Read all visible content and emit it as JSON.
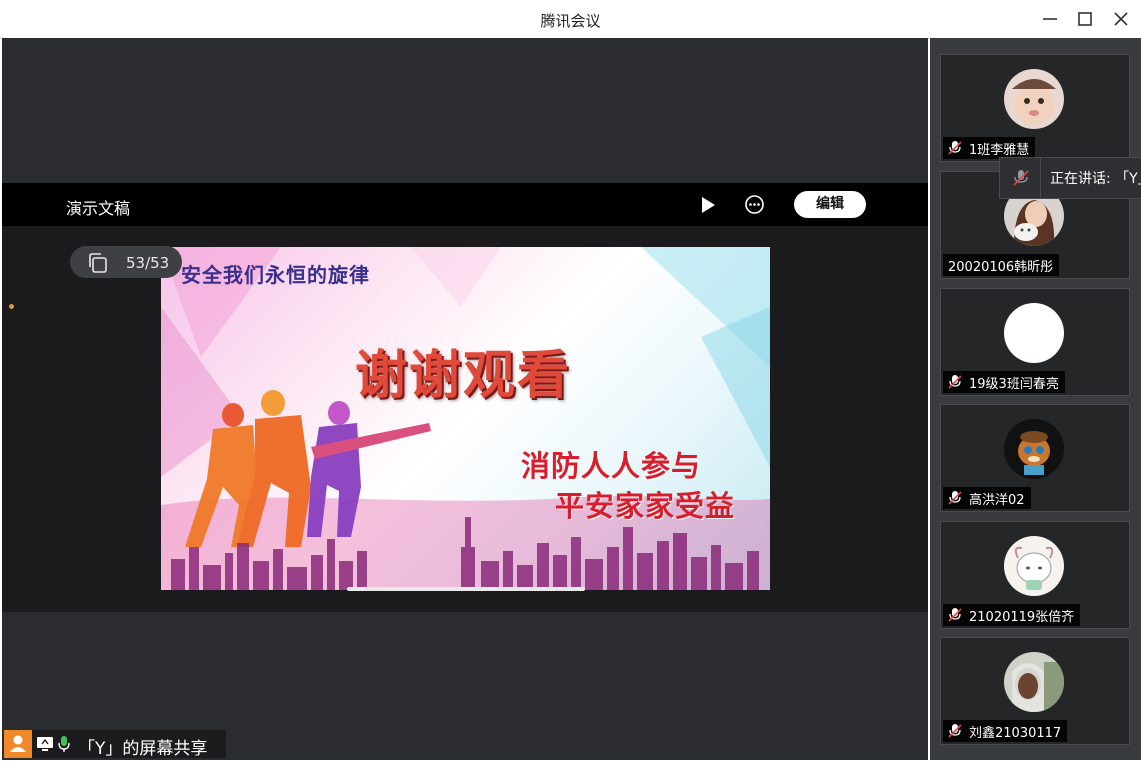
{
  "window": {
    "title": "腾讯会议"
  },
  "presentation": {
    "title": "演示文稿",
    "edit_label": "编辑",
    "page_indicator": "53/53"
  },
  "slide": {
    "top_line": "安全我们永恒的旋律",
    "main_text": "谢谢观看",
    "sub_line_1": "消防人人参与",
    "sub_line_2": "平安家家受益"
  },
  "share": {
    "label": "「Y」的屏幕共享"
  },
  "speaking": {
    "label": "正在讲话: 「Y」"
  },
  "participants": [
    {
      "name": "1班李雅慧",
      "muted": true
    },
    {
      "name": "20020106韩昕彤",
      "muted": false
    },
    {
      "name": "19级3班闫春亮",
      "muted": true
    },
    {
      "name": "高洪洋02",
      "muted": true
    },
    {
      "name": "21020119张倍齐",
      "muted": true
    },
    {
      "name": "刘鑫21030117",
      "muted": true
    }
  ],
  "colors": {
    "accent_orange": "#f0892a",
    "stage_bg": "#2b2c2f",
    "sidebar_bg": "#3a3b3e",
    "slide_red": "#d81e2c"
  }
}
